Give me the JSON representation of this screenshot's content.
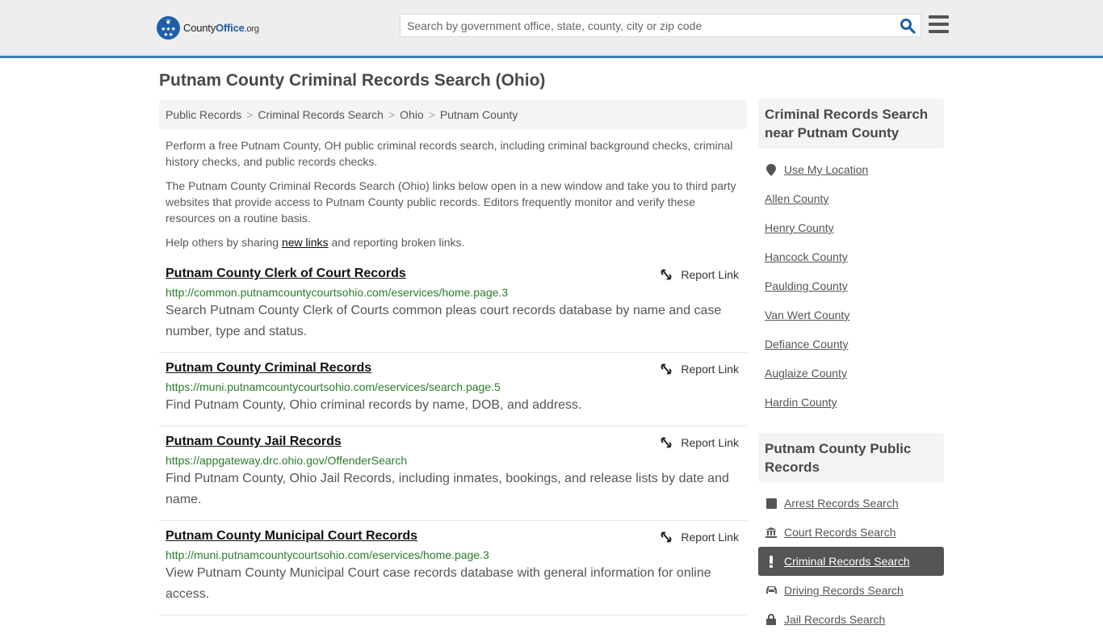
{
  "header": {
    "logo": {
      "prefix": "County",
      "brand": "Office",
      "tld": ".org"
    },
    "search": {
      "placeholder": "Search by government office, state, county, city or zip code",
      "value": ""
    },
    "icons": {
      "search": "search-icon",
      "menu": "hamburger-menu-icon"
    }
  },
  "page": {
    "title": "Putnam County Criminal Records Search (Ohio)",
    "breadcrumb": [
      "Public Records",
      "Criminal Records Search",
      "Ohio",
      "Putnam County"
    ],
    "intro": {
      "p1": "Perform a free Putnam County, OH public criminal records search, including criminal background checks, criminal history checks, and public records checks.",
      "p2": "The Putnam County Criminal Records Search (Ohio) links below open in a new window and take you to third party websites that provide access to Putnam County public records. Editors frequently monitor and verify these resources on a routine basis.",
      "p3_before": "Help others by sharing ",
      "p3_link": "new links",
      "p3_after": " and reporting broken links."
    }
  },
  "listings": [
    {
      "title": "Putnam County Clerk of Court Records",
      "url": "http://common.putnamcountycourtsohio.com/eservices/home.page.3",
      "description": "Search Putnam County Clerk of Courts common pleas court records database by name and case number, type and status.",
      "report_label": "Report Link"
    },
    {
      "title": "Putnam County Criminal Records",
      "url": "https://muni.putnamcountycourtsohio.com/eservices/search.page.5",
      "description": "Find Putnam County, Ohio criminal records by name, DOB, and address.",
      "report_label": "Report Link"
    },
    {
      "title": "Putnam County Jail Records",
      "url": "https://appgateway.drc.ohio.gov/OffenderSearch",
      "description": "Find Putnam County, Ohio Jail Records, including inmates, bookings, and release lists by date and name.",
      "report_label": "Report Link"
    },
    {
      "title": "Putnam County Municipal Court Records",
      "url": "http://muni.putnamcountycourtsohio.com/eservices/home.page.3",
      "description": "View Putnam County Municipal Court case records database with general information for online access.",
      "report_label": "Report Link"
    }
  ],
  "sidebar": {
    "nearby": {
      "heading": "Criminal Records Search near Putnam County",
      "use_location": "Use My Location",
      "counties": [
        "Allen County",
        "Henry County",
        "Hancock County",
        "Paulding County",
        "Van Wert County",
        "Defiance County",
        "Auglaize County",
        "Hardin County"
      ]
    },
    "public_records": {
      "heading": "Putnam County Public Records",
      "items": [
        {
          "label": "Arrest Records Search",
          "icon": "square-icon",
          "active": false
        },
        {
          "label": "Court Records Search",
          "icon": "courthouse-icon",
          "active": false
        },
        {
          "label": "Criminal Records Search",
          "icon": "exclamation-icon",
          "active": true
        },
        {
          "label": "Driving Records Search",
          "icon": "car-icon",
          "active": false
        },
        {
          "label": "Jail Records Search",
          "icon": "lock-icon",
          "active": false
        }
      ]
    }
  },
  "colors": {
    "brand_blue": "#1f5fa8",
    "header_border": "#3a7fb5",
    "url_green": "#2a7d2a",
    "active_bg": "#555555"
  }
}
